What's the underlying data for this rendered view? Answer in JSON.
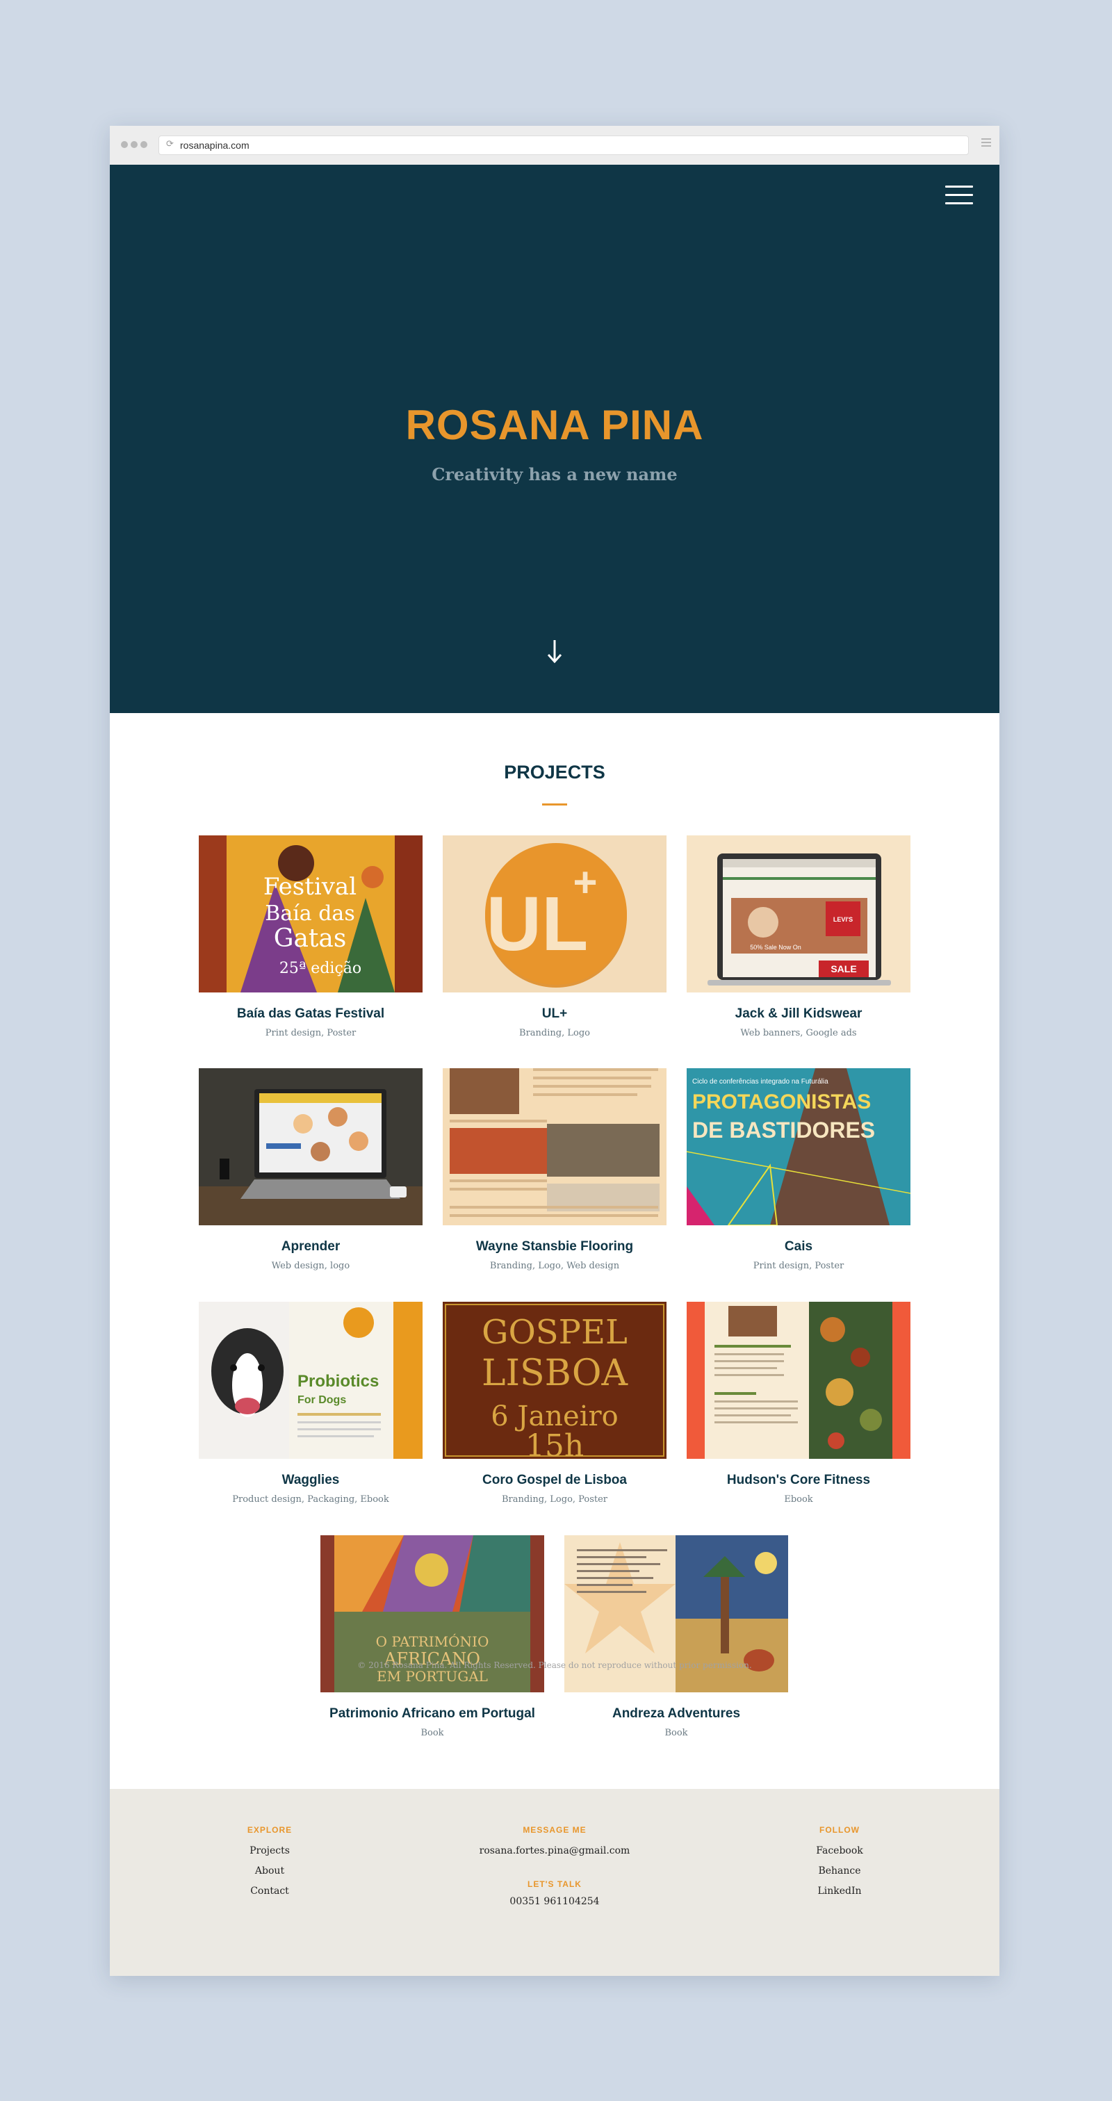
{
  "browser": {
    "url": "rosanapina.com"
  },
  "hero": {
    "title": "ROSANA PINA",
    "subtitle": "Creativity has a new name",
    "bg_color": "#0f3646",
    "accent_color": "#e8962c"
  },
  "projects": {
    "heading": "PROJECTS",
    "items": [
      {
        "title": "Baía das Gatas Festival",
        "categories": "Print design, Poster",
        "thumb_text": [
          "Festival",
          "Baía das",
          "Gatas",
          "25ª edição"
        ]
      },
      {
        "title": "UL+",
        "categories": "Branding, Logo",
        "thumb_text": [
          "UL",
          "+"
        ]
      },
      {
        "title": "Jack & Jill Kidswear",
        "categories": "Web banners, Google ads",
        "thumb_text": [
          "LEVI'S",
          "50% Sale Now On",
          "SALE"
        ]
      },
      {
        "title": "Aprender",
        "categories": "Web design, logo",
        "thumb_text": []
      },
      {
        "title": "Wayne Stansbie Flooring",
        "categories": "Branding, Logo, Web design",
        "thumb_text": []
      },
      {
        "title": "Cais",
        "categories": "Print design, Poster",
        "thumb_text": [
          "Ciclo de conferências integrado na Futurália",
          "PROTAGONISTAS",
          "DE BASTIDORES"
        ]
      },
      {
        "title": "Wagglies",
        "categories": "Product design, Packaging, Ebook",
        "thumb_text": [
          "Probiotics",
          "For Dogs"
        ]
      },
      {
        "title": "Coro Gospel de Lisboa",
        "categories": "Branding, Logo, Poster",
        "thumb_text": [
          "GOSPEL",
          "LISBOA",
          "6 Janeiro",
          "15h"
        ]
      },
      {
        "title": "Hudson's Core Fitness",
        "categories": "Ebook",
        "thumb_text": []
      },
      {
        "title": "Patrimonio Africano em Portugal",
        "categories": "Book",
        "thumb_text": [
          "O PATRIMÓNIO",
          "AFRICANO",
          "EM PORTUGAL"
        ]
      },
      {
        "title": "Andreza Adventures",
        "categories": "Book",
        "thumb_text": []
      }
    ]
  },
  "footer": {
    "explore": {
      "heading": "EXPLORE",
      "links": [
        "Projects",
        "About",
        "Contact"
      ]
    },
    "message": {
      "heading": "MESSAGE ME",
      "email": "rosana.fortes.pina@gmail.com",
      "talk_heading": "LET'S TALK",
      "phone": "00351 961104254"
    },
    "follow": {
      "heading": "FOLLOW",
      "links": [
        "Facebook",
        "Behance",
        "LinkedIn"
      ]
    },
    "copyright": "© 2016 Rosana Pina. All Rights Reserved. Please do not reproduce without prior permission."
  }
}
